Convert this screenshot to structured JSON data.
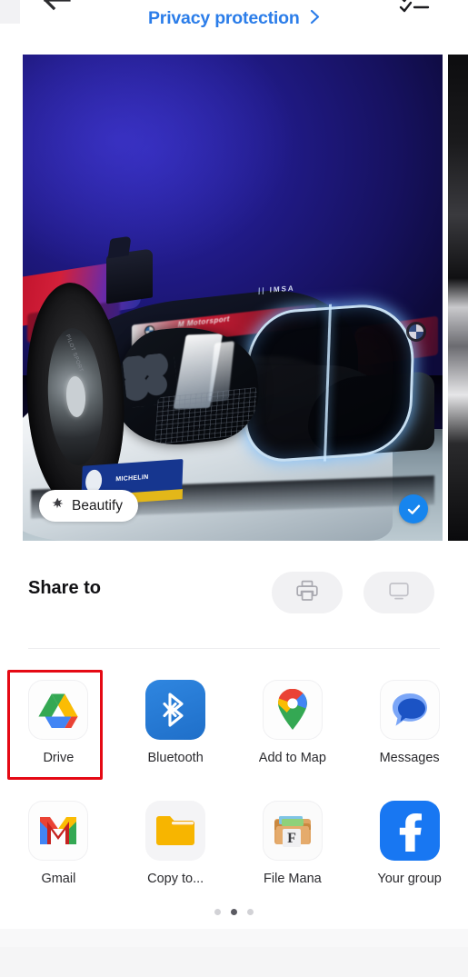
{
  "topbar": {
    "back_icon": "back-arrow-icon",
    "title": "Privacy protection",
    "chevron": "›",
    "menu_icon": "checklist-icon"
  },
  "preview": {
    "photo_alt": "BMW M Hybrid V8 IMSA race car",
    "beautify_label": "Beautify",
    "beautify_icon": "magic-wand-icon",
    "selected_icon": "check-icon",
    "selected": true,
    "accent_blue": "#1785ee",
    "car_badges": {
      "imsa": "IMSA",
      "michelin": "MICHELIN",
      "m_motorsport": "M Motorsport"
    }
  },
  "share": {
    "title": "Share to",
    "print_icon": "printer-icon",
    "cast_icon": "cast-screen-icon"
  },
  "apps": {
    "rows": [
      [
        {
          "label": "Drive",
          "icon": "google-drive-icon",
          "selected": true
        },
        {
          "label": "Bluetooth",
          "icon": "bluetooth-icon",
          "selected": false
        },
        {
          "label": "Add to Map",
          "icon": "google-maps-icon",
          "selected": false
        },
        {
          "label": "Messages",
          "icon": "google-messages-icon",
          "selected": false
        }
      ],
      [
        {
          "label": "Gmail",
          "icon": "gmail-icon",
          "selected": false
        },
        {
          "label": "Copy to...",
          "icon": "folder-icon",
          "selected": false
        },
        {
          "label": "File Mana",
          "icon": "file-manager-icon",
          "selected": false
        },
        {
          "label": "Your group",
          "icon": "facebook-icon",
          "selected": false
        }
      ]
    ],
    "selection_highlight_color": "#e50914"
  },
  "pagination": {
    "total": 3,
    "active_index": 1
  }
}
